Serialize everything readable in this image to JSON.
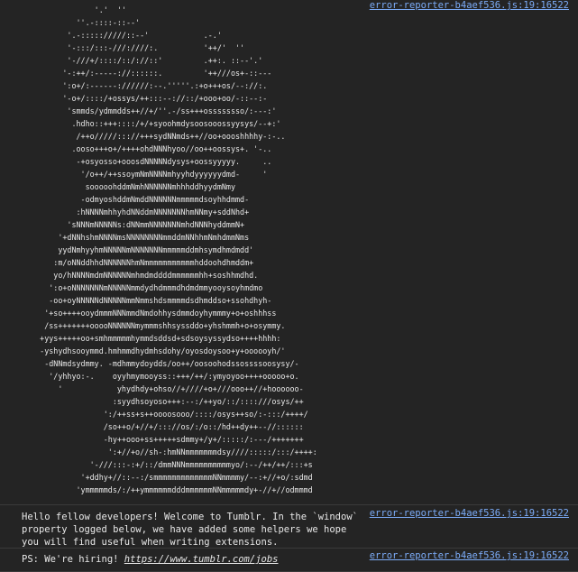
{
  "messages": [
    {
      "source": "error-reporter-b4aef536.js:19:16522",
      "art": "                '.'  ''\n            ''.-::::-::--'\n          '.-::::://///::--'            .-.'\n          '-:::/:::-///:////:.          '++/'  ''\n          '-///+/::::/::/://::'         .++:. ::--'.'\n         '-:++/:-----://::::::.         '++///os+-::---\n         ':o+/:------://////:--.'''''.:+o+++os/--://:.\n         '-o+/::::/+ossys/++:::--://::/+ooo+oo/-::--:-\n          'smmds/ydmmdds++//+/''.-/ss+++ossssssso/:---:'\n           .hdho::+++::::/+/+syoohmdysoosooossyysys/--+:'\n            /++o/////::://+++sydNNmds++//oo+oooshhhhy-:-..\n           .ooso+++o+/++++ohdNNNhyoo//oo++oossys+. '-..\n            -+osyosso+ooosdNNNNNdysys+oossyyyyy.     ..\n             '/o++/++ssoymNmNNNNmhyyhdyyyyyydmd-     '\n              sooooohddmNmhNNNNNNmhhhddhyydmNmy\n             -odmyoshddmNmddNNNNNNmmmmmdsoyhhdmmd-\n            :hNNNNmhhyhdNNddmNNNNNNNhmNNmy+sddNhd+\n          'sNNNmNNNNNs:dNNmmNNNNNNNmhdNNNhyddmmN+\n        '+dNNhshmNNNNmsNNNNNNNNmmddmNNhhmNmhdmmNms\n        yydNmhyyhmNNNNNmNNNNNNNmmmmmddmhsymdhmdmdd'\n       :m/oNNddhhdNNNNNNhmNmmmmmmmmmmmhddoohdhmddm+\n       yo/hNNNNmdmNNNNNNmhmdmddddmmmmmmhh+soshhmdhd.\n      ':o+oNNNNNNNmNNNNNmmdydhdmmmdhdmdmmyooysoyhmdmo\n      -oo+oyNNNNNdNNNNNmmNmmshdsmmmmdsdhmddso+ssohdhyh-\n     '+so++++ooydmmmNNNmmdNmdohhysdmmdoyhymmmy+o+oshhhss\n     /ss+++++++ooooNNNNNNmymmmshhsyssddo+yhshmmh+o+osymmy.\n    +yys+++++oo+smhmmmmmhymmdsddsd+sdsoysyssydso++++hhhh:\n    -yshydhsooymmd.hmhmmdhydmhsdohy/oyosdoysoo+y+oooooyh/'\n     -dNNmdsydmmy. -mdhmmydoydds/oo++/oosoohodssossssoosysy/-\n      '/yhhyo:-.    oyyhmymooyss::+++/++/:ymyoyoo++++ooooo+o.\n        '            yhydhdy+ohso//+////+o+///ooo++//+hoooooo-\n                    :syydhsoyoso+++:--:/++yo/::/::::///osys/++\n                  ':/++ss+s++oooosooo/::::/osys++so/:-:::/++++/\n                  /so++o/+//+/::://os/:/o::/hd++dy++--//::::::\n                  -hy++ooo+ss+++++sdmmy+/y+/:::::/:---/+++++++\n                   ':+//+o//sh-:hmNNmmmmmmmdsy////:::::/:::/++++:\n               '-///:::-:+/::/dmmNNNmmmmmmmmmmyo/:--/++/++/:::+s\n             '+ddhy+//::--:/smmmmmmmmmmmmmNNmmmmy/--:+//+o/:sdmd\n            'ymmmmmds/:/++ymmmmmmdddmmmmmmNNmmmmmdy+-//+//odmmmd"
    },
    {
      "source": "error-reporter-b4aef536.js:19:16522",
      "text": "Hello fellow developers! Welcome to Tumblr. In the `window` property logged below, we have added some helpers we hope you will find useful when writing extensions."
    },
    {
      "source": "error-reporter-b4aef536.js:19:16522",
      "text_prefix": "PS: We're hiring! ",
      "link": "https://www.tumblr.com/jobs"
    }
  ]
}
